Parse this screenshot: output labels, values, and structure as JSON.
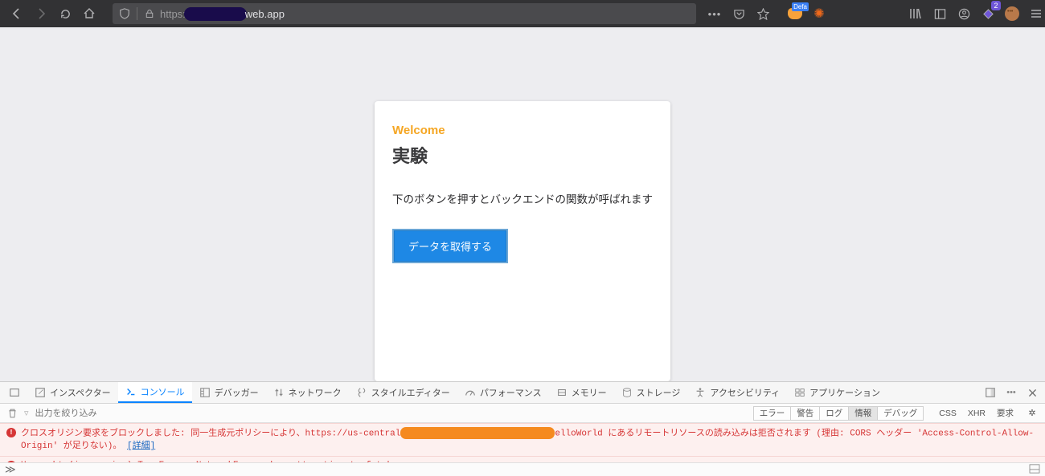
{
  "browser": {
    "url_protocol": "https:",
    "url_domain_tail": "web.app",
    "menu_dots": "•••"
  },
  "toolbar_icons": {
    "defa_label": "Defa",
    "badge_count": "2"
  },
  "page": {
    "welcome": "Welcome",
    "title": "実験",
    "desc": "下のボタンを押すとバックエンドの関数が呼ばれます",
    "button": "データを取得する"
  },
  "devtools": {
    "tabs": {
      "inspector": "インスペクター",
      "console": "コンソール",
      "debugger": "デバッガー",
      "network": "ネットワーク",
      "style": "スタイルエディター",
      "performance": "パフォーマンス",
      "memory": "メモリー",
      "storage": "ストレージ",
      "a11y": "アクセシビリティ",
      "application": "アプリケーション"
    },
    "filter_placeholder": "出力を絞り込み",
    "pills": {
      "error": "エラー",
      "warn": "警告",
      "log": "ログ",
      "info": "情報",
      "debug": "デバッグ",
      "css": "CSS",
      "xhr": "XHR",
      "req": "要求"
    },
    "errors": {
      "cors_pre": "クロスオリジン要求をブロックしました: 同一生成元ポリシーにより、https://us-central",
      "cors_mid": "elloWorld にあるリモートリソースの読み込みは拒否されます (理由: CORS ヘッダー 'Access-Control-Allow-Origin' が足りない)。 ",
      "details_link": "[詳細]",
      "uncaught": "Uncaught (in promise) TypeError: NetworkError when attempting to fetch resource."
    },
    "prompt": "≫"
  }
}
